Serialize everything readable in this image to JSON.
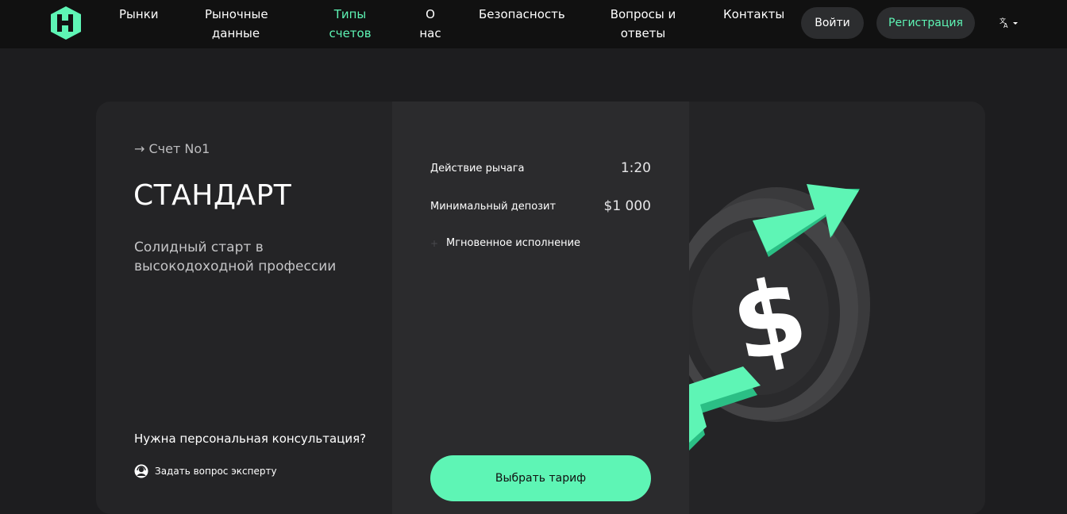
{
  "nav": {
    "items": [
      {
        "label": "Рынки"
      },
      {
        "label": "Рыночные данные"
      },
      {
        "label": "Типы счетов"
      },
      {
        "label": "О нас"
      },
      {
        "label": "Безопасность"
      },
      {
        "label": "Вопросы и ответы"
      },
      {
        "label": "Контакты"
      }
    ],
    "active_index": 2,
    "login_label": "Войти",
    "register_label": "Регистрация",
    "language_icon": "translate-icon"
  },
  "account": {
    "number_label": "→ Счет No1",
    "title": "СТАНДАРТ",
    "description": "Солидный старт в высокодоходной профессии",
    "consult_title": "Нужна персональная консультация?",
    "ask_label": "Задать вопрос эксперту"
  },
  "specs": [
    {
      "label": "Действие рычага",
      "value": "1:20"
    },
    {
      "label": "Минимальный депозит",
      "value": "$1 000"
    }
  ],
  "features": [
    {
      "label": "Мгновенное исполнение"
    }
  ],
  "choose_label": "Выбрать тариф",
  "colors": {
    "accent": "#5ef5b5",
    "header_bg": "#111111",
    "page_bg": "#1d1d1f",
    "card_bg": "#242426",
    "card_mid_bg": "#2b2b2d"
  }
}
